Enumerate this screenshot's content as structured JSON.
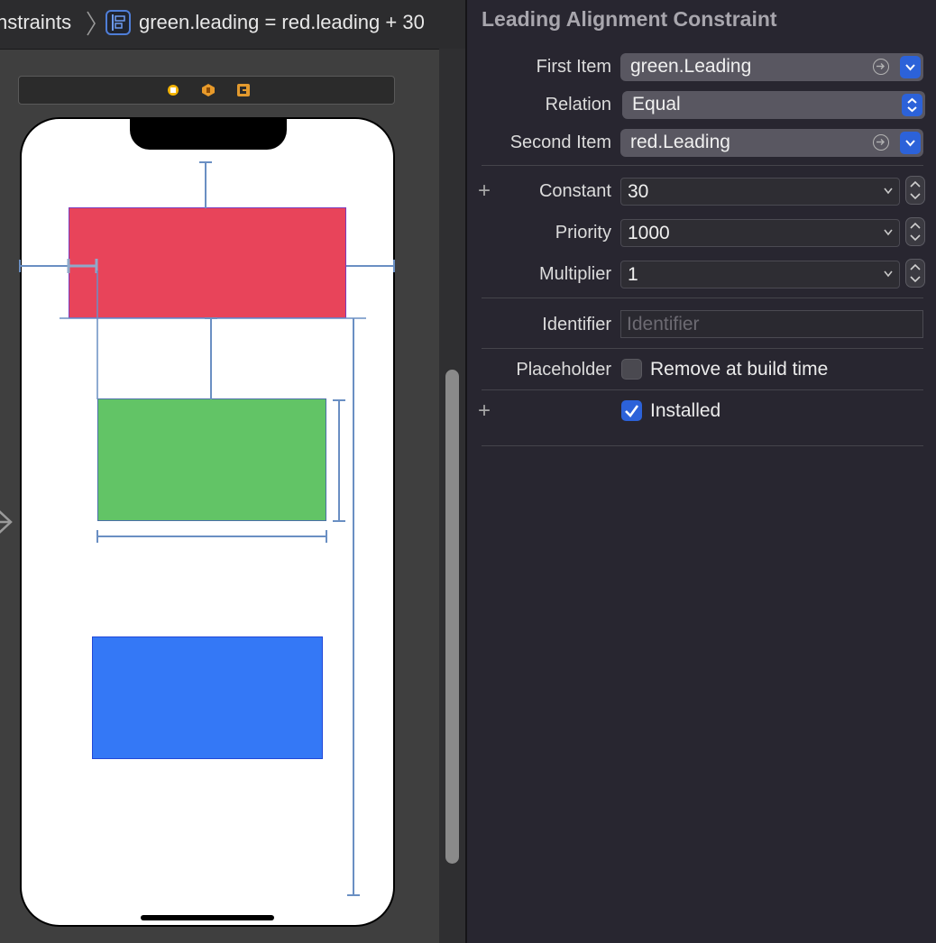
{
  "jump_bar": {
    "parent_label": "nstraints",
    "separator_icon": "chevron-right-icon",
    "constraint_icon": "leading-alignment-constraint-icon",
    "title": "green.leading = red.leading + 30"
  },
  "scene_bar_icons": [
    "view-controller-icon",
    "first-responder-icon",
    "exit-icon"
  ],
  "canvas": {
    "views": [
      {
        "name": "red",
        "color": "#e8445a"
      },
      {
        "name": "green",
        "color": "#62c466"
      },
      {
        "name": "blue",
        "color": "#3478f6"
      }
    ],
    "constraint_color": "#6a8fc3"
  },
  "inspector": {
    "title": "Leading Alignment Constraint",
    "first_item": {
      "label": "First Item",
      "value": "green.Leading"
    },
    "relation": {
      "label": "Relation",
      "value": "Equal"
    },
    "second_item": {
      "label": "Second Item",
      "value": "red.Leading"
    },
    "constant": {
      "label": "Constant",
      "value": "30"
    },
    "priority": {
      "label": "Priority",
      "value": "1000"
    },
    "multiplier": {
      "label": "Multiplier",
      "value": "1"
    },
    "identifier": {
      "label": "Identifier",
      "placeholder": "Identifier"
    },
    "placeholder": {
      "label": "Placeholder",
      "checkbox_label": "Remove at build time",
      "checked": false
    },
    "installed": {
      "checkbox_label": "Installed",
      "checked": true
    },
    "plus_symbol": "+",
    "accent_color": "#2c62d9"
  }
}
